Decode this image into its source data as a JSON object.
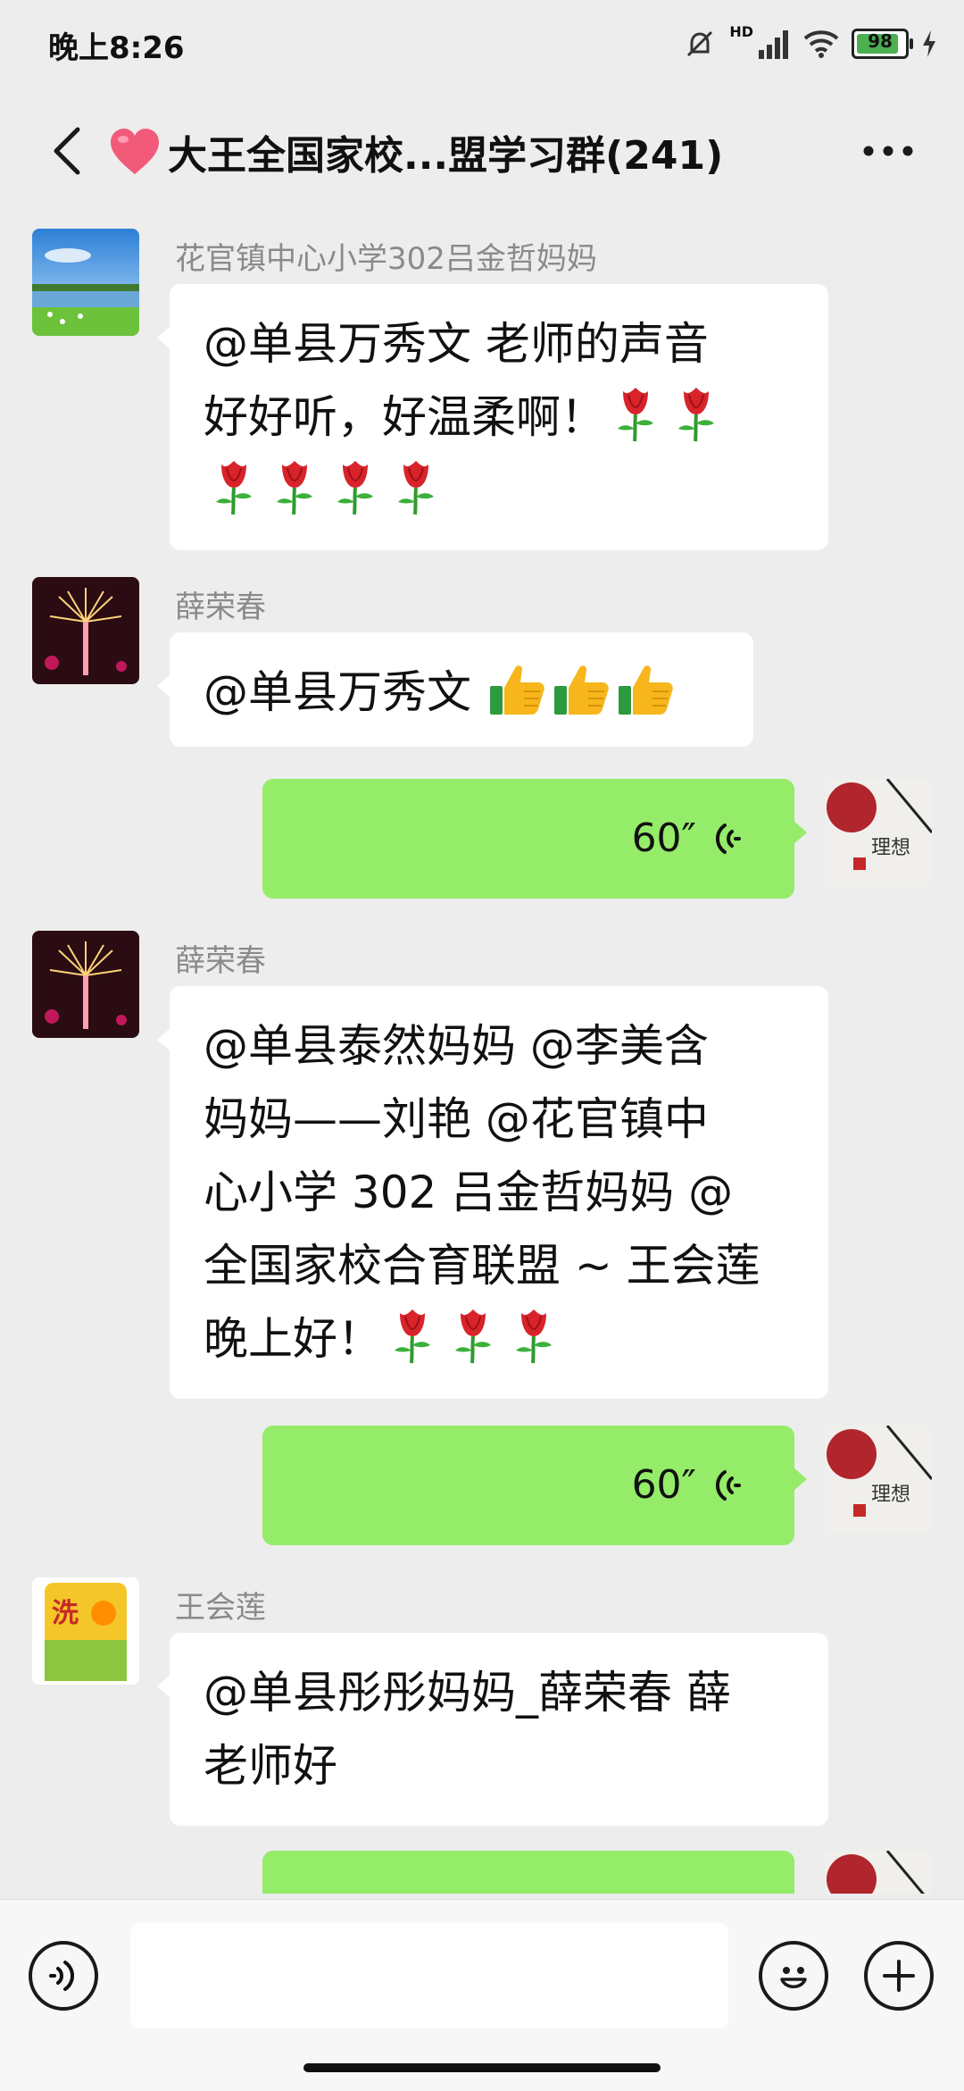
{
  "status": {
    "time": "晚上8:26",
    "battery": "98",
    "network": "HD"
  },
  "nav": {
    "title": "大王全国家校...盟学习群(241)"
  },
  "messages": [
    {
      "sender": "花官镇中心小学302吕金哲妈妈",
      "lines": [
        "@单县万秀文  老师的声音",
        "好好听，好温柔啊！"
      ],
      "emoji": "rose-emoji"
    },
    {
      "sender": "薛荣春",
      "text": "@单县万秀文",
      "emoji": "thumbs-up-emoji"
    },
    {
      "voice": "60″"
    },
    {
      "sender": "薛荣春",
      "lines": [
        "@单县泰然妈妈  @李美含",
        "妈妈——刘艳  @花官镇中",
        "心小学 302 吕金哲妈妈  @",
        "全国家校合育联盟 ~ 王会莲",
        " 晚上好！"
      ],
      "emoji": "rose-emoji"
    },
    {
      "voice": "60″"
    },
    {
      "sender": "王会莲",
      "lines": [
        "@单县彤彤妈妈_薛荣春  薛",
        "老师好"
      ]
    }
  ],
  "input": {
    "placeholder": ""
  },
  "colors": {
    "background": "#ededed",
    "outgoing_bubble": "#95ec69",
    "incoming_bubble": "#ffffff"
  },
  "icons": [
    "back-icon",
    "heart-icon",
    "more-icon",
    "voice-input-icon",
    "emoji-icon",
    "plus-icon",
    "rose-emoji",
    "thumbs-up-emoji",
    "voice-wave-icon"
  ]
}
